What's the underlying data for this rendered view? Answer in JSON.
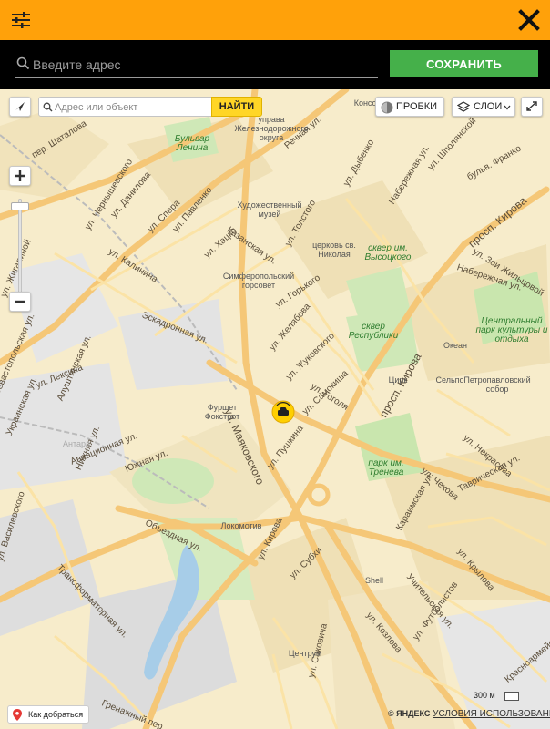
{
  "header": {
    "menu_icon": "sliders-icon",
    "close_icon": "close-icon",
    "accent_color": "#ffa10a"
  },
  "address_bar": {
    "placeholder": "Введите адрес",
    "save_label": "СОХРАНИТЬ",
    "save_color": "#45b04a"
  },
  "map": {
    "search_placeholder": "Адрес или объект",
    "search_button": "НАЙТИ",
    "traffic_label": "ПРОБКИ",
    "layers_label": "СЛОИ",
    "scale_label": "300 м",
    "route_label": "Как добраться",
    "copyright_brand": "© ЯНДЕКС",
    "terms_label": "УСЛОВИЯ ИСПОЛЬЗОВАНИЯ",
    "streets": [
      "пер. Шаталова",
      "ул. Чернышевского",
      "ул. Данилова",
      "ул. Спера",
      "ул. Павленко",
      "ул. Хацко",
      "Казанская ул.",
      "ул. Калинина",
      "ул. Жигалиной",
      "Эскадронная ул.",
      "ул. Толстого",
      "ул. Горького",
      "ул. Желябова",
      "ул. Жуковского",
      "ул. Гоголя",
      "ул. Самокиша",
      "ул. Маяковского",
      "ул. Пушкина",
      "просп. Кирова",
      "ул. Дыбенко",
      "ул. Шполянской",
      "Набережная ул.",
      "ул. Зои Жильцовой",
      "бульв. Франко",
      "Речная ул.",
      "ул. Лексина",
      "Авиационная ул.",
      "Южная ул.",
      "Объездная ул.",
      "ул. Кирова",
      "ул. Субхи",
      "ул. Козлова",
      "ул. Крылова",
      "Караимская ул.",
      "ул. Чехова",
      "ул. Некрасова",
      "Таврическая ул.",
      "Учительская ул.",
      "ул. Футболистов",
      "Трансформаторная ул.",
      "ул. Василевского",
      "Гренажный пер.",
      "ул. Саковича",
      "Нижняя ул.",
      "Алуштинская ул.",
      "Украинская ул.",
      "Севастопольская ул.",
      "Красноармейская ул."
    ],
    "places": [
      "управа Железнодорожного округа",
      "Бульвар Ленина",
      "Художественный музей",
      "церковь св. Николая",
      "сквер им. Высоцкого",
      "Симферопольский горсовет",
      "сквер Республики",
      "Центральный парк культуры и отдыха",
      "Океан",
      "Цирк",
      "Сельпо",
      "Петропавловский собор",
      "Фуршет Фокстрот",
      "Антара",
      "парк им. Тренева",
      "Локомотив",
      "Shell",
      "Центрум",
      "Консоль"
    ]
  }
}
